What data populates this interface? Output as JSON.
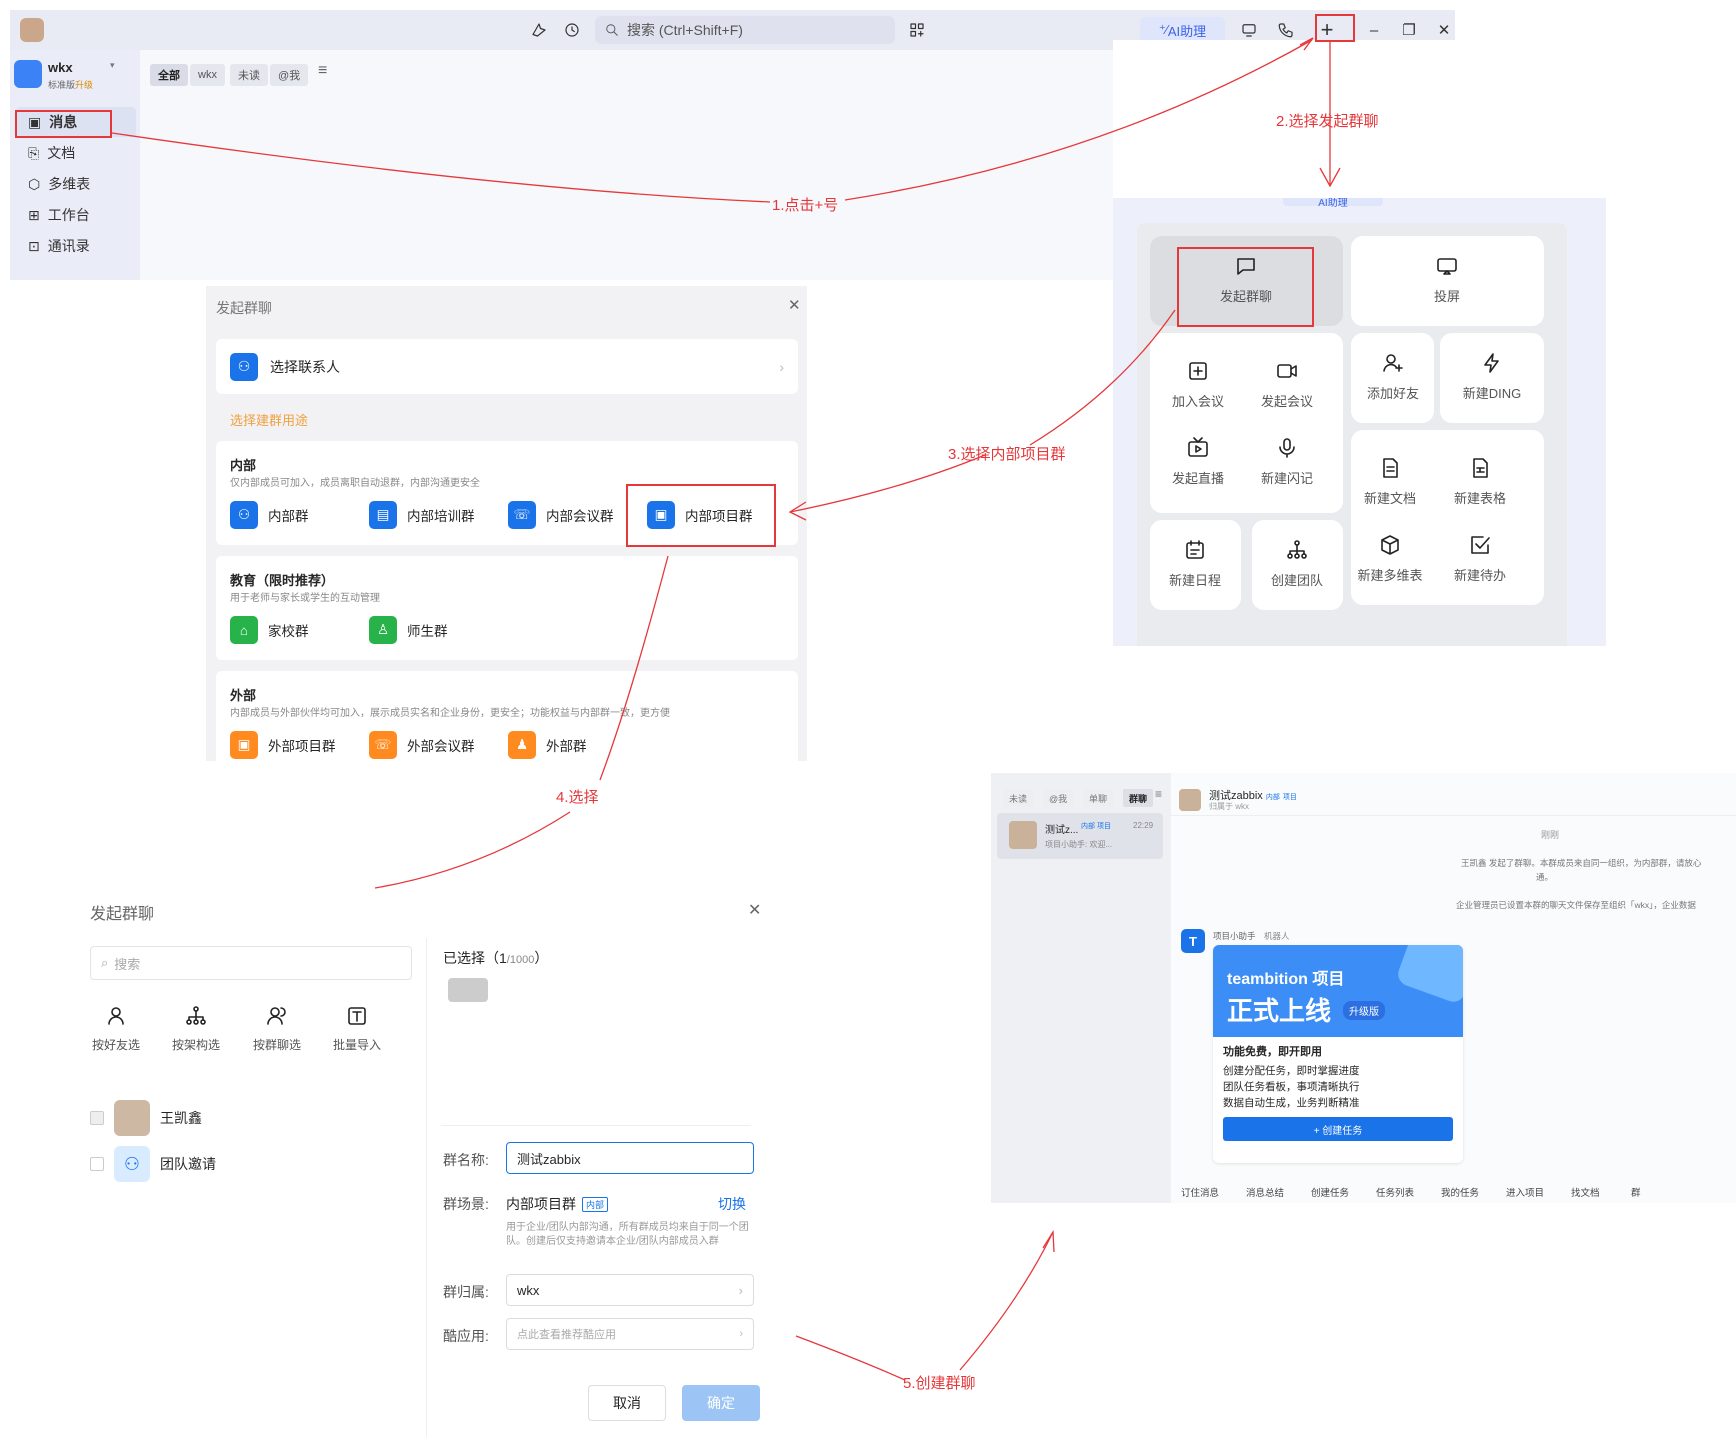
{
  "main_window": {
    "search_placeholder": "搜索 (Ctrl+Shift+F)",
    "ai_label": "AI助理",
    "user": {
      "name": "wkx",
      "plan": "标准版",
      "upgrade": "升级"
    },
    "sidebar": [
      {
        "label": "消息",
        "icon": "message-icon"
      },
      {
        "label": "文档",
        "icon": "doc-icon"
      },
      {
        "label": "多维表",
        "icon": "table-icon"
      },
      {
        "label": "工作台",
        "icon": "grid-icon"
      },
      {
        "label": "通讯录",
        "icon": "contacts-icon"
      }
    ],
    "filter_tabs": [
      "全部",
      "wkx",
      "未读",
      "@我"
    ]
  },
  "plus_menu": {
    "peek_label": "AI助理",
    "items": [
      "发起群聊",
      "投屏",
      "加入会议",
      "发起会议",
      "添加好友",
      "新建DING",
      "发起直播",
      "新建闪记",
      "新建文档",
      "新建表格",
      "新建日程",
      "创建团队",
      "新建多维表",
      "新建待办"
    ]
  },
  "dialog1": {
    "title": "发起群聊",
    "select_contacts": "选择联系人",
    "purpose_label": "选择建群用途",
    "internal": {
      "title": "内部",
      "desc": "仅内部成员可加入，成员离职自动退群，内部沟通更安全",
      "groups": [
        "内部群",
        "内部培训群",
        "内部会议群",
        "内部项目群"
      ]
    },
    "education": {
      "title": "教育（限时推荐）",
      "desc": "用于老师与家长或学生的互动管理",
      "groups": [
        "家校群",
        "师生群"
      ]
    },
    "external": {
      "title": "外部",
      "desc": "内部成员与外部伙伴均可加入，展示成员实名和企业身份，更安全；功能权益与内部群一致，更方便",
      "groups": [
        "外部项目群",
        "外部会议群",
        "外部群"
      ]
    }
  },
  "dialog2": {
    "title": "发起群聊",
    "search_placeholder": "搜索",
    "filters": [
      "按好友选",
      "按架构选",
      "按群聊选",
      "批量导入"
    ],
    "list": [
      "王凯鑫",
      "团队邀请"
    ],
    "selected_label": "已选择（",
    "selected_count": "1",
    "selected_max": "/1000",
    "selected_close": "）",
    "name_label": "群名称:",
    "name_value": "测试zabbix",
    "scene_label": "群场景:",
    "scene_value": "内部项目群",
    "scene_tag": "内部",
    "scene_switch": "切换",
    "scene_desc": "用于企业/团队内部沟通，所有群成员均来自于同一个团队。创建后仅支持邀请本企业/团队内部成员入群",
    "owner_label": "群归属:",
    "owner_value": "wkx",
    "app_label": "酷应用:",
    "app_placeholder": "点此查看推荐酷应用",
    "cancel": "取消",
    "confirm": "确定"
  },
  "chat": {
    "tabs": [
      "未读",
      "@我",
      "单聊",
      "群聊"
    ],
    "list_item": {
      "name": "测试z...",
      "tags": [
        "内部",
        "项目"
      ],
      "time": "22:29",
      "preview": "项目小助手: 欢迎..."
    },
    "header": {
      "title": "测试zabbix",
      "tags": [
        "内部",
        "项目"
      ],
      "sub": "归属于 wkx"
    },
    "time_divider": "刚刚",
    "sys1": "王凯鑫 发起了群聊。本群成员来自同一组织，为内部群，请放心",
    "sys1b": "通。",
    "sys2": "企业管理员已设置本群的聊天文件保存至组织「wkx」，企业数据",
    "bot_name": "项目小助手",
    "bot_tag": "机器人",
    "card": {
      "brand": "teambition 项目",
      "headline": "正式上线",
      "badge": "升级版",
      "feat_title": "功能免费，即开即用",
      "feats": [
        "创建分配任务，即时掌握进度",
        "团队任务看板，事项清晰执行",
        "数据自动生成，业务判断精准"
      ],
      "button": "+ 创建任务"
    },
    "tools": [
      "订住消息",
      "消息总结",
      "创建任务",
      "任务列表",
      "我的任务",
      "进入项目",
      "找文档",
      "群"
    ]
  },
  "annotations": [
    "1.点击+号",
    "2.选择发起群聊",
    "3.选择内部项目群",
    "4.选择",
    "5.创建群聊"
  ],
  "colors": {
    "accent": "#1a73e8",
    "annotation": "#e5383b",
    "orange": "#ff8a1f",
    "green": "#27b34a"
  }
}
